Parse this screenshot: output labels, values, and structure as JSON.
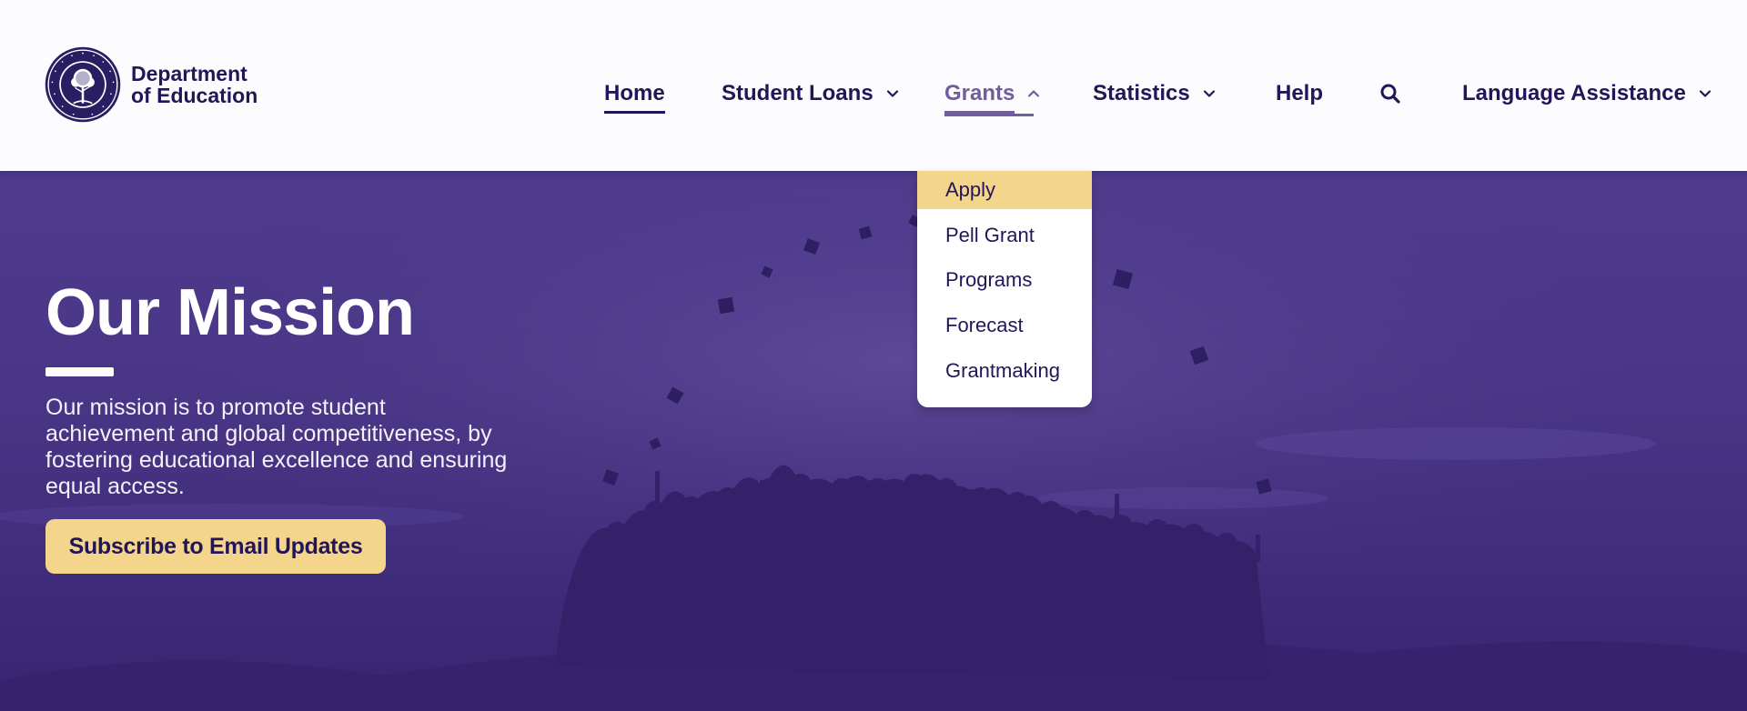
{
  "brand": {
    "line1": "Department",
    "line2": "of Education",
    "seal_icon": "department-of-education-seal",
    "seal_text": "DEPARTMENT OF EDUCATION · UNITED STATES OF AMERICA"
  },
  "nav": {
    "items": [
      {
        "label": "Home",
        "icon": null
      },
      {
        "label": "Student Loans",
        "icon": "chevron-down-icon"
      },
      {
        "label": "Grants",
        "icon": "chevron-up-icon"
      },
      {
        "label": "Statistics",
        "icon": "chevron-down-icon"
      },
      {
        "label": "Help",
        "icon": null
      },
      {
        "label": "Language Assistance",
        "icon": "chevron-down-icon"
      }
    ],
    "search_icon": "search-icon"
  },
  "dropdown": {
    "items": [
      "Apply",
      "Pell Grant",
      "Programs",
      "Forecast",
      "Grantmaking"
    ]
  },
  "hero": {
    "title": "Our Mission",
    "body": "Our mission is to promote student achievement and global competitiveness, by fostering educational excellence and ensuring equal access.",
    "cta": "Subscribe to Email Updates"
  },
  "colors": {
    "navy": "#231557",
    "active": "#6f5e9a",
    "accent": "#f3d58c",
    "hero": "#4a3686"
  }
}
